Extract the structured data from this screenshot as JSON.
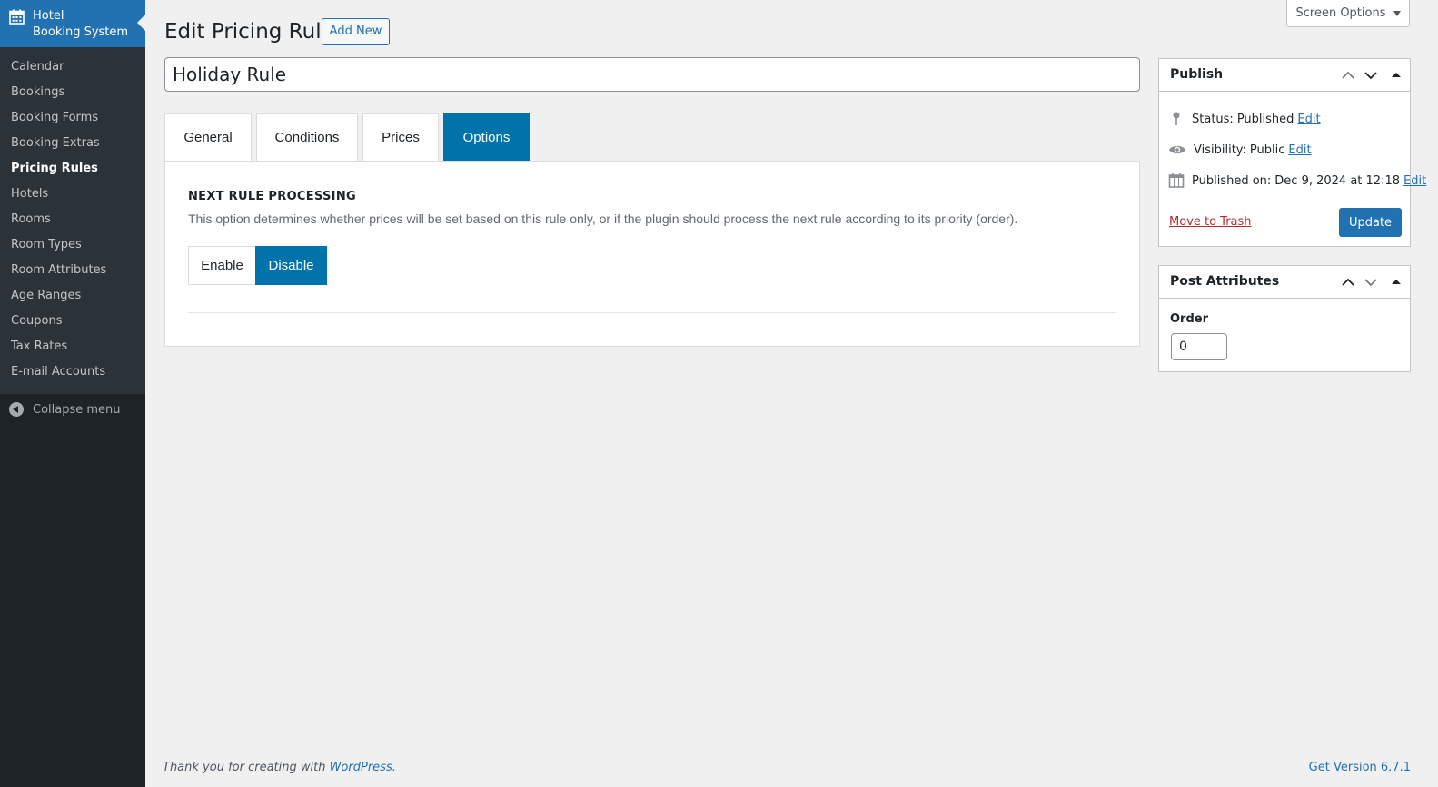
{
  "sidebar": {
    "plugin_title_line1": "Hotel",
    "plugin_title_line2": "Booking System",
    "items": [
      {
        "label": "Calendar"
      },
      {
        "label": "Bookings"
      },
      {
        "label": "Booking Forms"
      },
      {
        "label": "Booking Extras"
      },
      {
        "label": "Pricing Rules"
      },
      {
        "label": "Hotels"
      },
      {
        "label": "Rooms"
      },
      {
        "label": "Room Types"
      },
      {
        "label": "Room Attributes"
      },
      {
        "label": "Age Ranges"
      },
      {
        "label": "Coupons"
      },
      {
        "label": "Tax Rates"
      },
      {
        "label": "E-mail Accounts"
      }
    ],
    "current_item": "Pricing Rules",
    "collapse_label": "Collapse menu"
  },
  "header": {
    "title": "Edit Pricing Rule",
    "add_new_label": "Add New",
    "screen_options_label": "Screen Options"
  },
  "post": {
    "title_value": "Holiday Rule"
  },
  "tabs": [
    {
      "label": "General"
    },
    {
      "label": "Conditions"
    },
    {
      "label": "Prices"
    },
    {
      "label": "Options"
    }
  ],
  "active_tab": "Options",
  "options_panel": {
    "section_title": "NEXT RULE PROCESSING",
    "description": "This option determines whether prices will be set based on this rule only, or if the plugin should process the next rule according to its priority (order).",
    "enable_label": "Enable",
    "disable_label": "Disable",
    "selected": "Disable"
  },
  "publish_box": {
    "title": "Publish",
    "status_label": "Status:",
    "status_value": "Published",
    "visibility_label": "Visibility:",
    "visibility_value": "Public",
    "published_on_label": "Published on:",
    "published_on_value": "Dec 9, 2024 at 12:18",
    "edit_label": "Edit",
    "trash_label": "Move to Trash",
    "update_label": "Update"
  },
  "attributes_box": {
    "title": "Post Attributes",
    "order_label": "Order",
    "order_value": "0"
  },
  "footer": {
    "thanks_prefix": "Thank you for creating with ",
    "thanks_link": "WordPress",
    "thanks_suffix": ".",
    "version": "Get Version 6.7.1"
  },
  "colors": {
    "accent": "#2271b1",
    "tab_active": "#0073aa",
    "sidebar_bg": "#1d2327",
    "submenu_bg": "#2c3338",
    "trash": "#b32d2e"
  }
}
